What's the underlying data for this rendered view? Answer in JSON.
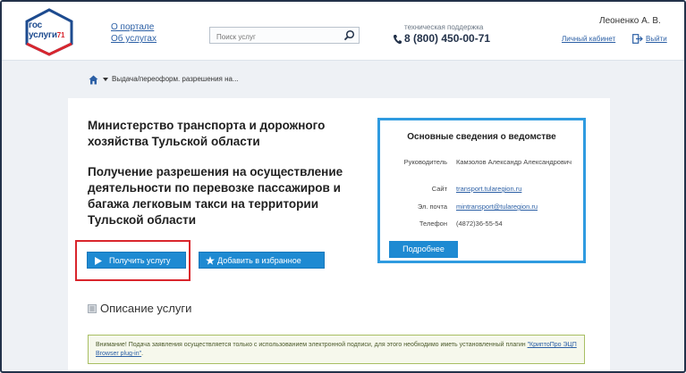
{
  "header": {
    "logo": {
      "line1": "гос",
      "line2": "услуги",
      "region": "71"
    },
    "links": {
      "about_portal": "О портале",
      "about_services": "Об услугах"
    },
    "search": {
      "placeholder": "Поиск услуг"
    },
    "support": {
      "label": "техническая поддержка",
      "phone": "8 (800) 450-00-71"
    },
    "user": {
      "name": "Леоненко А. В.",
      "cabinet": "Личный кабинет",
      "logout": "Выйти"
    }
  },
  "breadcrumb": {
    "current": "Выдача/переоформ. разрешения на..."
  },
  "main": {
    "ministry": "Министерство транспорта и дорожного хозяйства Тульской области",
    "service_title": "Получение разрешения на осуществление деятельности по перевозке пассажиров и багажа легковым такси на территории Тульской области",
    "get_service_label": "Получить услугу",
    "favorite_label": "Добавить в избранное",
    "description_heading": "Описание услуги",
    "notice": {
      "text": "Внимание! Подача заявления осуществляется только с использованием электронной подписи, для этого необходимо иметь установленный плагин ",
      "link": "\"КриптоПро ЭЦП Browser plug-in\"",
      "tail": "."
    }
  },
  "info_box": {
    "title": "Основные сведения о ведомстве",
    "rows": [
      {
        "key": "Руководитель",
        "value": "Камзолов Александр Александрович"
      },
      {
        "key": "Сайт",
        "value": "transport.tularegion.ru"
      },
      {
        "key": "Эл. почта",
        "value": "mintransport@tularegion.ru"
      },
      {
        "key": "Телефон",
        "value": "(4872)36-55-54"
      }
    ],
    "more_label": "Подробнее"
  },
  "colors": {
    "accent_blue": "#1e8ad2",
    "highlight_red": "#d9252c",
    "info_border": "#2f9be0",
    "notice_border": "#a8bf63"
  }
}
